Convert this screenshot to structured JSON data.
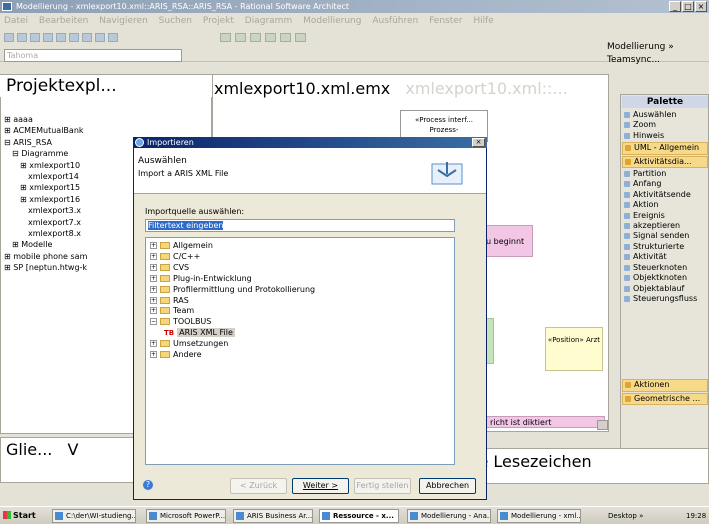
{
  "window": {
    "title": "Modellierung - xmlexport10.xml::ARIS_RSA::ARIS_RSA - Rational Software Architect",
    "min": "_",
    "max": "□",
    "close": "×"
  },
  "menu": [
    "Datei",
    "Bearbeiten",
    "Navigieren",
    "Suchen",
    "Projekt",
    "Diagramm",
    "Modellierung",
    "Ausführen",
    "Fenster",
    "Hilfe"
  ],
  "toolbar": {
    "font_box": "Tahoma",
    "perspective_label": "Modellierung",
    "perspective_more": "»",
    "teamsync": "Teamsync..."
  },
  "left_panel": {
    "tab_title": "Projektexpl...",
    "tree": [
      "⊞ aaaa",
      "⊞ ACMEMutualBank",
      "⊟ ARIS_RSA",
      "⊟ Diagramme",
      "⊞ xmlexport10",
      "xmlexport14",
      "⊞ xmlexport15",
      "⊞ xmlexport16",
      "xmlexport3.x",
      "xmlexport7.x",
      "xmlexport8.x",
      "⊞ Modelle",
      "⊞ mobile phone sam",
      "⊞ SP [neptun.htwg-k"
    ]
  },
  "editor": {
    "tab_active": "xmlexport10.xml.emx",
    "tab_inactive": "xmlexport10.xml::...",
    "shapes": {
      "process_top": "«Process interf... Prozess-",
      "pink_text": "u beginnt",
      "position": "«Position» Arzt",
      "pink_bottom": "richt ist diktiert"
    }
  },
  "palette": {
    "title": "Palette",
    "items": [
      {
        "label": "Auswählen",
        "cat": false
      },
      {
        "label": "Zoom",
        "cat": false
      },
      {
        "label": "Hinweis",
        "cat": false
      },
      {
        "label": "UML - Allgemein",
        "cat": true
      },
      {
        "label": "Aktivitätsdia...",
        "cat": true
      },
      {
        "label": "Partition",
        "cat": false
      },
      {
        "label": "Anfang",
        "cat": false
      },
      {
        "label": "Aktivitätsende",
        "cat": false
      },
      {
        "label": "Aktion",
        "cat": false
      },
      {
        "label": "Ereignis",
        "cat": false
      },
      {
        "label": "akzeptieren",
        "cat": false
      },
      {
        "label": "Signal senden",
        "cat": false
      },
      {
        "label": "Strukturierte",
        "cat": false
      },
      {
        "label": "Aktivität",
        "cat": false
      },
      {
        "label": "Steuerknoten",
        "cat": false
      },
      {
        "label": "Objektknoten",
        "cat": false
      },
      {
        "label": "Objektablauf",
        "cat": false
      },
      {
        "label": "Steuerungsfluss",
        "cat": false
      }
    ],
    "bottom_items": [
      "Aktionen",
      "Geometrische ..."
    ]
  },
  "bottom": {
    "left_tab": "Glie...",
    "left_tab2": "V",
    "right_tab": "le Lesezeichen"
  },
  "dialog": {
    "title": "Importieren",
    "header_title": "Auswählen",
    "header_sub": "Import a ARIS XML File",
    "source_label": "Importquelle auswählen:",
    "filter_placeholder": "Filtertext eingeben",
    "tree": [
      {
        "label": "Allgemein",
        "indent": 0,
        "exp": "+"
      },
      {
        "label": "C/C++",
        "indent": 0,
        "exp": "+"
      },
      {
        "label": "CVS",
        "indent": 0,
        "exp": "+"
      },
      {
        "label": "Plug-in-Entwicklung",
        "indent": 0,
        "exp": "+"
      },
      {
        "label": "Profilermittlung und Protokollierung",
        "indent": 0,
        "exp": "+"
      },
      {
        "label": "RAS",
        "indent": 0,
        "exp": "+"
      },
      {
        "label": "Team",
        "indent": 0,
        "exp": "+"
      },
      {
        "label": "TOOLBUS",
        "indent": 0,
        "exp": "−"
      },
      {
        "label": "ARIS XML File",
        "indent": 1,
        "exp": ""
      },
      {
        "label": "Umsetzungen",
        "indent": 0,
        "exp": "+"
      },
      {
        "label": "Andere",
        "indent": 0,
        "exp": "+"
      }
    ],
    "buttons": {
      "back": "< Zurück",
      "next": "Weiter >",
      "finish": "Fertig stellen",
      "cancel": "Abbrechen"
    },
    "help": "?"
  },
  "taskbar": {
    "start": "Start",
    "buttons": [
      "C:\\der\\WI-studieng...",
      "Microsoft PowerP...",
      "ARIS Business Ar...",
      "Ressource - x...",
      "Modellierung - Ana...",
      "Modellierung - xml..."
    ],
    "desktop": "Desktop »",
    "time": "19:28"
  }
}
